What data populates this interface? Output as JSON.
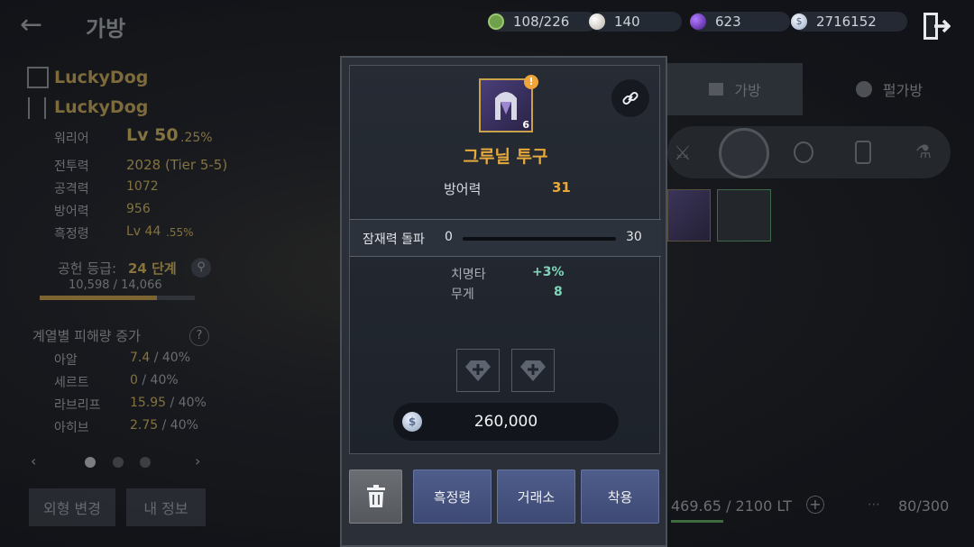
{
  "header": {
    "title": "가방",
    "resources": [
      {
        "icon": "potion-weight-icon",
        "value": "108/226",
        "color": "#7fbf5a"
      },
      {
        "icon": "pearl-icon",
        "value": "140",
        "color": "#d9d4cc"
      },
      {
        "icon": "purple-orb-icon",
        "value": "623",
        "color": "#7b3fd0"
      },
      {
        "icon": "silver-coin-icon",
        "value": "2716152",
        "color": "#c9d6ea"
      }
    ]
  },
  "character": {
    "family_name": "LuckyDog",
    "char_name": "LuckyDog",
    "class": "워리어",
    "level": "Lv 50",
    "level_pct": ".25%",
    "stats": [
      {
        "label": "전투력",
        "value": "2028 (Tier 5-5)"
      },
      {
        "label": "공격력",
        "value": "1072"
      },
      {
        "label": "방어력",
        "value": "956"
      },
      {
        "label": "흑정령",
        "value": "Lv 44",
        "sub": ".55%"
      }
    ],
    "contribution_label": "공헌 등급:",
    "contribution_value": "24 단계",
    "contribution_exp": "10,598 / 14,066",
    "contribution_progress": 0.753,
    "damage_title": "계열별 피해량 증가",
    "damage_rows": [
      {
        "label": "아알",
        "value": "7.4",
        "max": " / 40%"
      },
      {
        "label": "세르트",
        "value": "0",
        "max": " / 40%"
      },
      {
        "label": "라브리프",
        "value": "15.95",
        "max": " / 40%"
      },
      {
        "label": "아히브",
        "value": "2.75",
        "max": " / 40%"
      }
    ],
    "btn_appearance": "외형 변경",
    "btn_my_info": "내 정보"
  },
  "inventory": {
    "tab_bag": "가방",
    "tab_pearl_bag": "펄가방",
    "weight": "469.65 / 2100 LT",
    "slots": "80/300"
  },
  "item_popup": {
    "name": "그루닐 투구",
    "enhance_level": "6",
    "defense_label": "방어력",
    "defense_value": "31",
    "potential_label": "잠재력 돌파",
    "potential_min": "0",
    "potential_max": "30",
    "options": [
      {
        "label": "치명타",
        "value": "+3%"
      },
      {
        "label": "무게",
        "value": "8"
      }
    ],
    "price": "260,000",
    "buttons": {
      "black_spirit": "흑정령",
      "market": "거래소",
      "equip": "착용"
    }
  }
}
